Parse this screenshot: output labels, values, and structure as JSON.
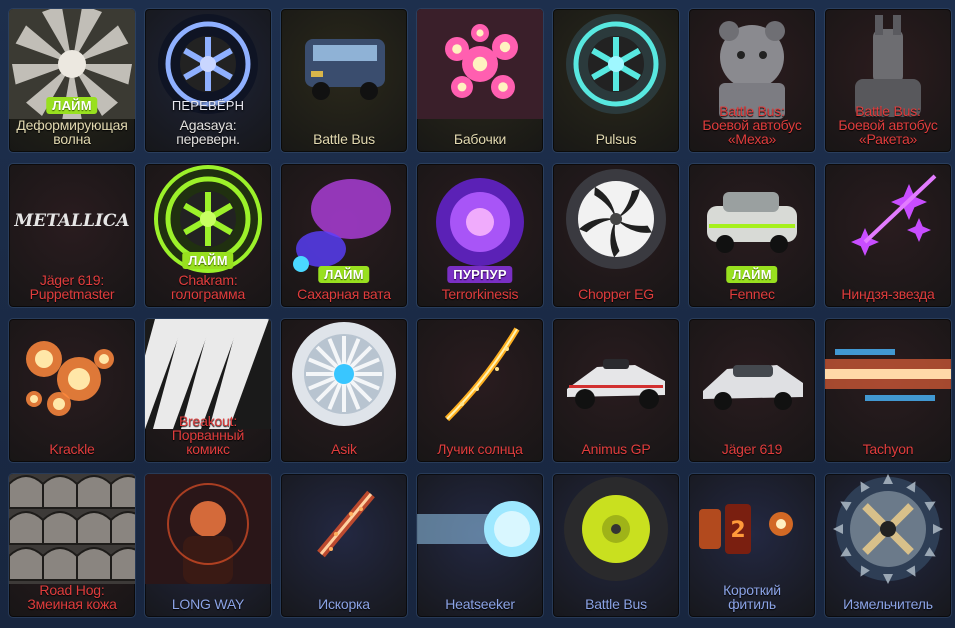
{
  "colors": {
    "uncommon": "#e2e0de",
    "rare": "#c7c9cf",
    "exotic": "#e2d9b0",
    "premium": "#e03d3d",
    "limited": "#8ba3e6",
    "grid_bg": "#1a2a44"
  },
  "items": [
    {
      "name": "Деформирующая волна",
      "lines": [
        "Деформирующая",
        "волна"
      ],
      "badge": "ЛАЙМ",
      "badge_color": "lime",
      "rarity": "exotic",
      "bg": "#29281a",
      "art": "warp-wave"
    },
    {
      "name": "Agasaya: переверн.",
      "lines": [
        "Agasaya:",
        "переверн."
      ],
      "badge": "ПЕРЕВЁРН",
      "badge_color": "inverted",
      "rarity": "uncommon",
      "bg": "#1f2438",
      "art": "wheel-blue"
    },
    {
      "name": "Battle Bus",
      "lines": [
        "Battle Bus"
      ],
      "badge": "",
      "rarity": "exotic",
      "bg": "#2b291b",
      "art": "bus"
    },
    {
      "name": "Бабочки",
      "lines": [
        "Бабочки"
      ],
      "badge": "",
      "rarity": "exotic",
      "bg": "#2b291b",
      "art": "flowers"
    },
    {
      "name": "Pulsus",
      "lines": [
        "Pulsus"
      ],
      "badge": "",
      "rarity": "exotic",
      "bg": "#2b291b",
      "art": "wheel-teal"
    },
    {
      "name": "Battle Bus: Боевой автобус «Меха»",
      "lines": [
        "Battle Bus:",
        "Боевой автобус",
        "«Меха»"
      ],
      "badge": "",
      "rarity": "premium",
      "bg": "#2c1c1e",
      "art": "bear"
    },
    {
      "name": "Battle Bus: Боевой автобус «Ракета»",
      "lines": [
        "Battle Bus:",
        "Боевой автобус",
        "«Ракета»"
      ],
      "badge": "",
      "rarity": "premium",
      "bg": "#2c1c1e",
      "art": "llama"
    },
    {
      "name": "Jäger 619: Puppetmaster",
      "lines": [
        "Jäger 619:",
        "Puppetmaster"
      ],
      "badge": "",
      "rarity": "premium",
      "bg": "#2a1c1f",
      "art": "metallica",
      "logo_text": "METALLICA"
    },
    {
      "name": "Chakram: голограмма",
      "lines": [
        "Chakram:",
        "голограмма"
      ],
      "badge": "ЛАЙМ",
      "badge_color": "lime",
      "rarity": "premium",
      "bg": "#2a1c1f",
      "art": "wheel-lime"
    },
    {
      "name": "Сахарная вата",
      "lines": [
        "Сахарная вата"
      ],
      "badge": "ЛАЙМ",
      "badge_color": "lime",
      "rarity": "premium",
      "bg": "#2a1c1f",
      "art": "cotton"
    },
    {
      "name": "Terrorkinesis",
      "lines": [
        "Terrorkinesis"
      ],
      "badge": "ПУРПУР",
      "badge_color": "purple",
      "rarity": "premium",
      "bg": "#2a1c1f",
      "art": "purple-orb"
    },
    {
      "name": "Chopper EG",
      "lines": [
        "Chopper EG"
      ],
      "badge": "",
      "rarity": "premium",
      "bg": "#2a1c1f",
      "art": "wheel-chopper"
    },
    {
      "name": "Fennec",
      "lines": [
        "Fennec"
      ],
      "badge": "ЛАЙМ",
      "badge_color": "lime",
      "rarity": "premium",
      "bg": "#2a1c1f",
      "art": "car-fennec"
    },
    {
      "name": "Ниндзя-звезда",
      "lines": [
        "Ниндзя-звезда"
      ],
      "badge": "",
      "rarity": "premium",
      "bg": "#2a1c1f",
      "art": "ninja-star"
    },
    {
      "name": "Krackle",
      "lines": [
        "Krackle"
      ],
      "badge": "",
      "rarity": "premium",
      "bg": "#2a1c1f",
      "art": "krackle"
    },
    {
      "name": "Breakout: Порванный комикс",
      "lines": [
        "Breakout:",
        "Порванный",
        "комикс"
      ],
      "badge": "",
      "rarity": "premium",
      "bg": "#2a1c1f",
      "art": "comic"
    },
    {
      "name": "Asik",
      "lines": [
        "Asik"
      ],
      "badge": "",
      "rarity": "premium",
      "bg": "#2a1c1f",
      "art": "wheel-asik"
    },
    {
      "name": "Лучик солнца",
      "lines": [
        "Лучик солнца"
      ],
      "badge": "",
      "rarity": "premium",
      "bg": "#2a1c1f",
      "art": "sunbeam"
    },
    {
      "name": "Animus GP",
      "lines": [
        "Animus GP"
      ],
      "badge": "",
      "rarity": "premium",
      "bg": "#2a1c1f",
      "art": "car-animus"
    },
    {
      "name": "Jäger 619",
      "lines": [
        "Jäger 619"
      ],
      "badge": "",
      "rarity": "premium",
      "bg": "#2a1c1f",
      "art": "car-jager"
    },
    {
      "name": "Tachyon",
      "lines": [
        "Tachyon"
      ],
      "badge": "",
      "rarity": "premium",
      "bg": "#2a1c1f",
      "art": "tachyon"
    },
    {
      "name": "Road Hog: Змеиная кожа",
      "lines": [
        "Road Hog:",
        "Змеиная кожа"
      ],
      "badge": "",
      "rarity": "premium",
      "bg": "#2a1c1f",
      "art": "snakeskin"
    },
    {
      "name": "LONG WAY",
      "lines": [
        "LONG WAY"
      ],
      "badge": "",
      "rarity": "limited",
      "bg": "#232842",
      "art": "anthem"
    },
    {
      "name": "Искорка",
      "lines": [
        "Искорка"
      ],
      "badge": "",
      "rarity": "limited",
      "bg": "#232842",
      "art": "spark"
    },
    {
      "name": "Heatseeker",
      "lines": [
        "Heatseeker"
      ],
      "badge": "",
      "rarity": "limited",
      "bg": "#232842",
      "art": "heatseeker"
    },
    {
      "name": "Battle Bus",
      "lines": [
        "Battle Bus"
      ],
      "badge": "",
      "rarity": "limited",
      "bg": "#232842",
      "art": "wheel-bus"
    },
    {
      "name": "Короткий фитиль",
      "lines": [
        "Короткий",
        "фитиль"
      ],
      "badge": "",
      "rarity": "limited",
      "bg": "#232842",
      "art": "fuse"
    },
    {
      "name": "Измельчитель",
      "lines": [
        "Измельчитель"
      ],
      "badge": "",
      "rarity": "limited",
      "bg": "#232842",
      "art": "wheel-grinder"
    }
  ]
}
